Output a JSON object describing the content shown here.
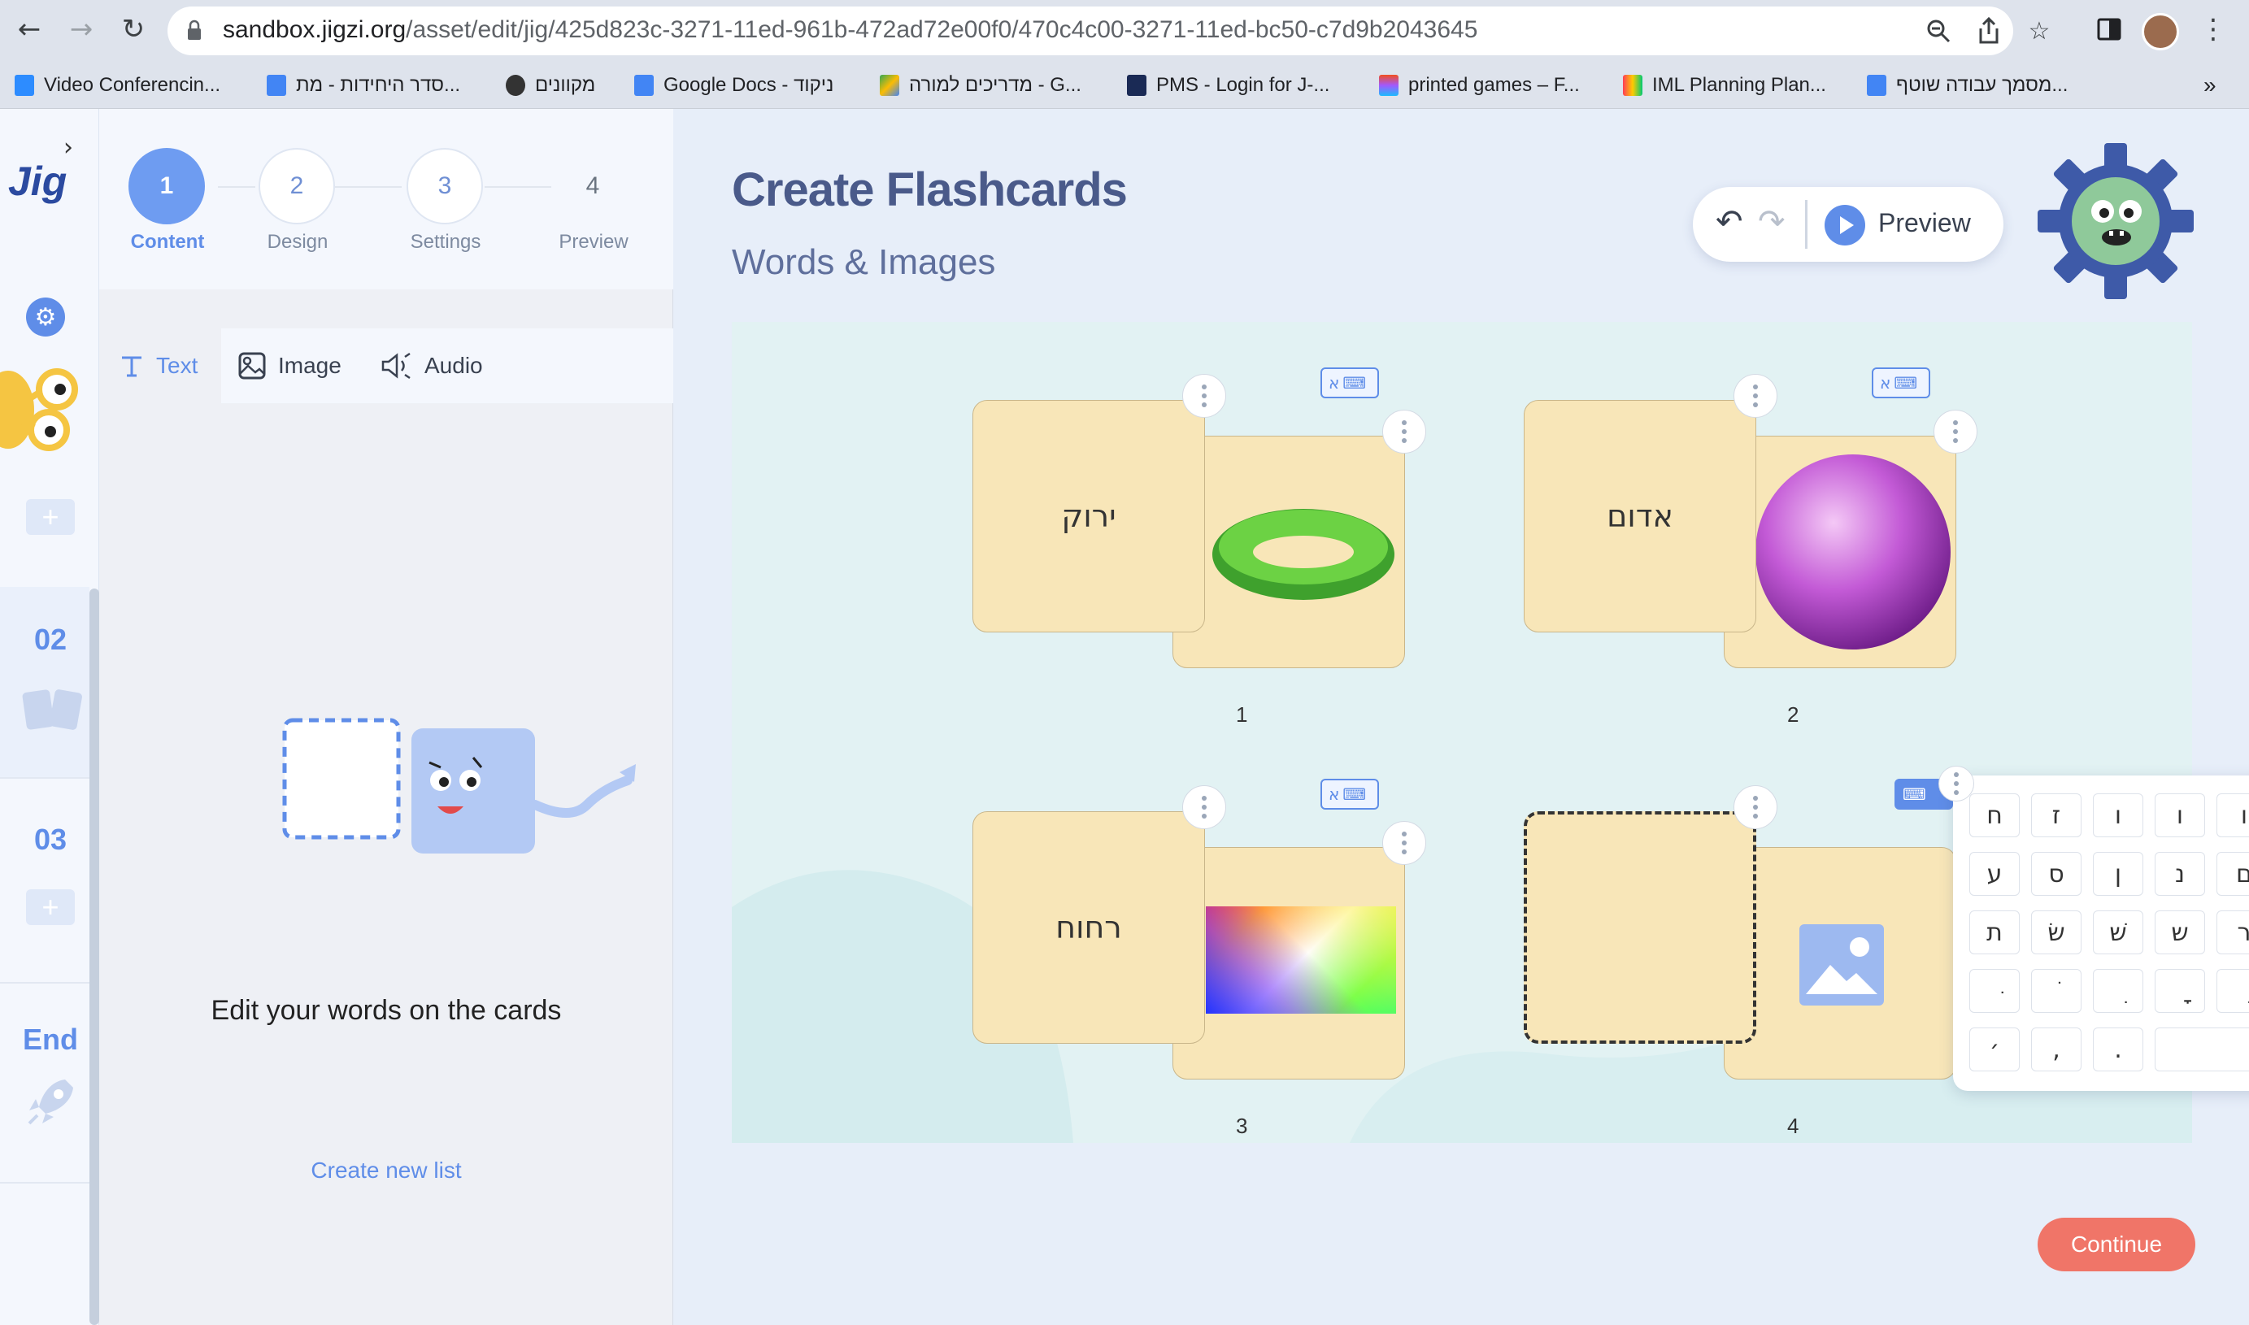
{
  "browser": {
    "url_host": "sandbox.jigzi.org",
    "url_path": "/asset/edit/jig/425d823c-3271-11ed-961b-472ad72e00f0/470c4c00-3271-11ed-bc50-c7d9b2043645",
    "bookmarks": [
      {
        "label": "Video Conferencin...",
        "color": "#2d8cff"
      },
      {
        "label": "סדר היחידות - מת...",
        "color": "#4285f4"
      },
      {
        "label": "מקוונים",
        "color": "#333333"
      },
      {
        "label": "Google Docs - ניקוד",
        "color": "#4285f4"
      },
      {
        "label": "מדריכים למורה - G...",
        "color": "#34a853"
      },
      {
        "label": "PMS - Login for J-...",
        "color": "#1a2a55"
      },
      {
        "label": "printed games – F...",
        "color": "#f24e1e"
      },
      {
        "label": "IML Planning Plan...",
        "color": "#ff3d57"
      },
      {
        "label": "מסמך עבודה שוטף...",
        "color": "#4285f4"
      }
    ],
    "more": "»"
  },
  "rail": {
    "logo": "Jig",
    "sections": [
      {
        "label": "02"
      },
      {
        "label": "03"
      },
      {
        "label": "End"
      }
    ]
  },
  "steps": [
    {
      "num": "1",
      "label": "Content"
    },
    {
      "num": "2",
      "label": "Design"
    },
    {
      "num": "3",
      "label": "Settings"
    },
    {
      "num": "4",
      "label": "Preview"
    }
  ],
  "tabs": [
    {
      "label": "Text"
    },
    {
      "label": "Image"
    },
    {
      "label": "Audio"
    }
  ],
  "panel": {
    "instruction": "Edit your words on the cards",
    "create_link": "Create new list"
  },
  "main": {
    "title": "Create Flashcards",
    "subtitle": "Words & Images",
    "preview_label": "Preview",
    "continue_label": "Continue"
  },
  "cards": [
    {
      "num": "1",
      "word": "ירוק",
      "image": "green-ring"
    },
    {
      "num": "2",
      "word": "אדום",
      "image": "purple-sphere"
    },
    {
      "num": "3",
      "word": "רחוח",
      "image": "color-gradient"
    },
    {
      "num": "4",
      "word": "",
      "image": "placeholder"
    }
  ],
  "keyboard_badge": "א",
  "keyboard": {
    "rows": [
      [
        "ח",
        "ז",
        "ו",
        "ו",
        "ו"
      ],
      [
        "ע",
        "ס",
        "ן",
        "נ",
        "ם"
      ],
      [
        "ת",
        "שׂ",
        "שׁ",
        "ש",
        "ר"
      ],
      [
        "ּ",
        "ׂ",
        "ִ",
        "ָ",
        "ַ"
      ],
      [
        "׳",
        ",",
        "."
      ]
    ]
  },
  "colors": {
    "accent": "#5f8de8",
    "continue": "#f07568",
    "card": "#f8e6b8",
    "title": "#4a5a8a"
  }
}
